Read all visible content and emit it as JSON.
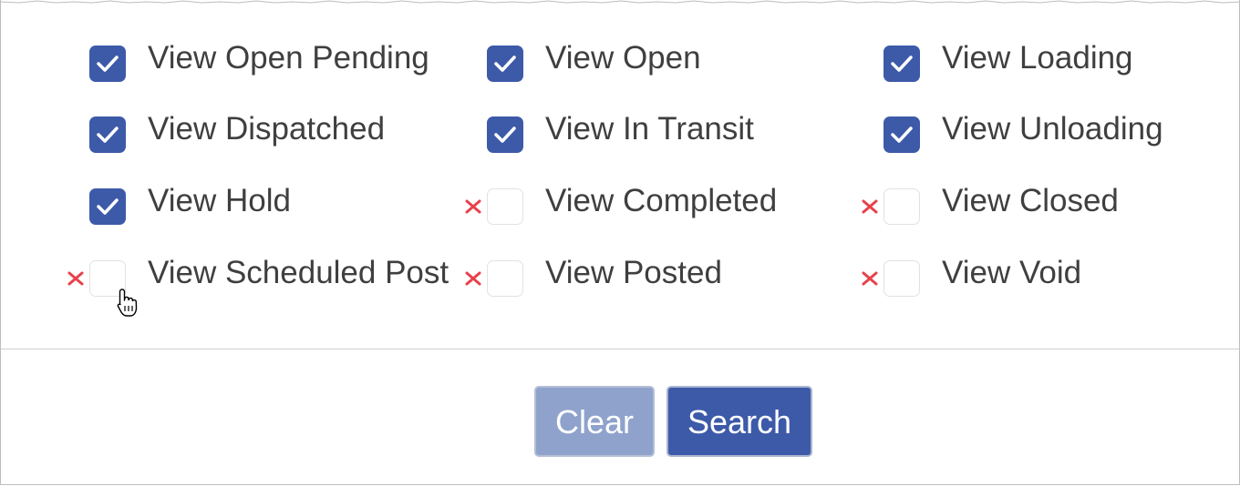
{
  "colors": {
    "accent": "#3d5aa9",
    "accent_disabled": "#8fa2cc",
    "label_text": "#3f3f3f",
    "x_mark": "#e8414a"
  },
  "options": [
    {
      "label": "View Open Pending",
      "checked": true
    },
    {
      "label": "View Open",
      "checked": true
    },
    {
      "label": "View Loading",
      "checked": true
    },
    {
      "label": "View Dispatched",
      "checked": true
    },
    {
      "label": "View In Transit",
      "checked": true
    },
    {
      "label": "View Unloading",
      "checked": true
    },
    {
      "label": "View Hold",
      "checked": true
    },
    {
      "label": "View Completed",
      "checked": false
    },
    {
      "label": "View Closed",
      "checked": false
    },
    {
      "label": "View Scheduled Post",
      "checked": false
    },
    {
      "label": "View Posted",
      "checked": false
    },
    {
      "label": "View Void",
      "checked": false
    }
  ],
  "buttons": {
    "clear_label": "Clear",
    "search_label": "Search"
  }
}
